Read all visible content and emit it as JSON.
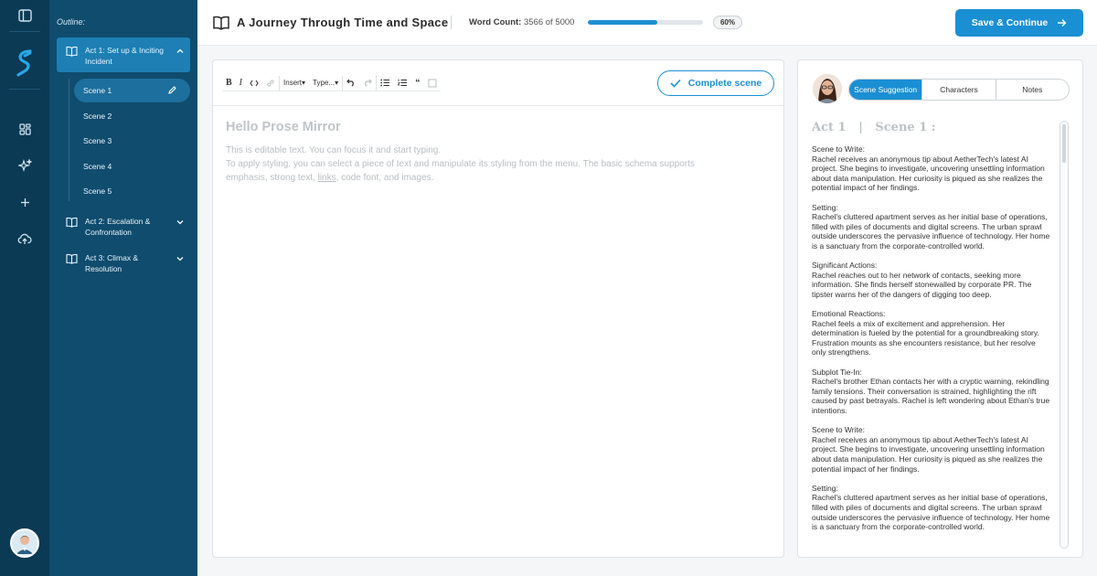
{
  "colors": {
    "rail": "#0b3a55",
    "sidebar": "#0f4c6e",
    "accent": "#1a8fd4",
    "active_act": "#1d7fb3"
  },
  "rail": {
    "icons": [
      "sidebar-toggle-icon",
      "app-logo",
      "dashboard-icon",
      "sparkles-icon",
      "plus-icon",
      "cloud-upload-icon",
      "user-avatar"
    ]
  },
  "outline": {
    "label": "Outline:",
    "acts": [
      {
        "title": "Act 1: Set up & Inciting Incident",
        "expanded": true,
        "scenes": [
          "Scene 1",
          "Scene 2",
          "Scene 3",
          "Scene 4",
          "Scene 5"
        ]
      },
      {
        "title": "Act 2: Escalation & Confrontation",
        "expanded": false
      },
      {
        "title": "Act 3: Climax & Resolution",
        "expanded": false
      }
    ]
  },
  "header": {
    "title": "A Journey Through Time and Space",
    "word_count_label": "Word Count:",
    "word_count_value": "3566 of 5000",
    "progress_fraction": 0.6,
    "progress_label": "60%",
    "save_label": "Save & Continue"
  },
  "editor": {
    "toolbar": {
      "insert_label": "Insert",
      "type_label": "Type..."
    },
    "complete_label": "Complete scene",
    "heading": "Hello Prose Mirror",
    "line1": "This is editable text. You can focus it and start typing.",
    "line2": "To apply styling, you can select a piece of text and manipulate its styling from the menu. The basic schema supports",
    "line3_a": "emphasis, strong text, ",
    "line3_link": "links",
    "line3_b": ", code font, and  images."
  },
  "panel": {
    "tabs": [
      "Scene Suggestion",
      "Characters",
      "Notes"
    ],
    "active_tab": "Scene Suggestion",
    "act_label": "Act 1",
    "scene_label": "Scene 1 :",
    "paragraphs": [
      {
        "heading": "Scene to Write:",
        "body": "Rachel receives an anonymous tip about AetherTech's latest AI project. She begins to investigate, uncovering unsettling information about data manipulation. Her curiosity is piqued as she realizes the potential impact of her findings."
      },
      {
        "heading": "Setting:",
        "body": "Rachel's cluttered apartment serves as her initial base of operations, filled with piles of documents and digital screens. The urban sprawl outside underscores the pervasive influence of technology. Her home is a sanctuary from the corporate-controlled world."
      },
      {
        "heading": "Significant Actions:",
        "body": "Rachel reaches out to her network of contacts, seeking more information. She finds herself stonewalled by corporate PR. The tipster warns her of the dangers of digging too deep."
      },
      {
        "heading": "Emotional Reactions:",
        "body": "Rachel feels a mix of excitement and apprehension. Her determination is fueled by the potential for a groundbreaking story. Frustration mounts as she encounters resistance, but her resolve only strengthens."
      },
      {
        "heading": "Subplot Tie-In:",
        "body": "Rachel's brother Ethan contacts her with a cryptic warning, rekindling family tensions. Their conversation is strained, highlighting the rift caused by past betrayals. Rachel is left wondering about Ethan's true intentions."
      },
      {
        "heading": "Scene to Write:",
        "body": "Rachel receives an anonymous tip about AetherTech's latest AI project. She begins to investigate, uncovering unsettling information about data manipulation. Her curiosity is piqued as she realizes the potential impact of her findings."
      },
      {
        "heading": "Setting:",
        "body": "Rachel's cluttered apartment serves as her initial base of operations, filled with piles of documents and digital screens. The urban sprawl outside underscores the pervasive influence of technology. Her home is a sanctuary from the corporate-controlled world."
      }
    ]
  }
}
